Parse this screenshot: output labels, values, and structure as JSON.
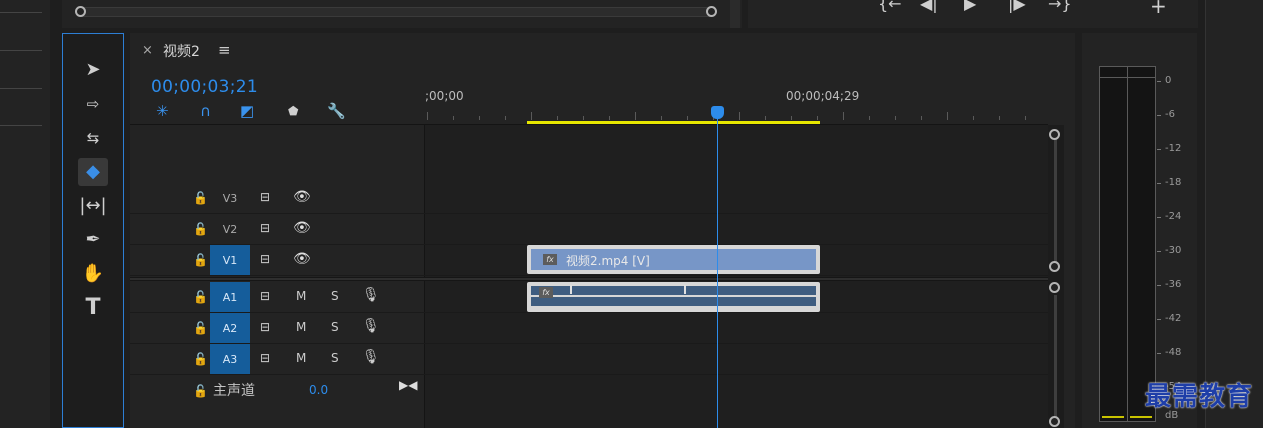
{
  "sequence": {
    "tab_title": "视频2",
    "close_glyph": "×",
    "menu_glyph": "≡",
    "timecode": "00;00;03;21"
  },
  "ruler": {
    "start_label": ";00;00",
    "end_label": "00;00;04;29"
  },
  "tracks": {
    "video": [
      {
        "name": "V3",
        "targeted": false
      },
      {
        "name": "V2",
        "targeted": false
      },
      {
        "name": "V1",
        "targeted": true
      }
    ],
    "audio": [
      {
        "name": "A1",
        "targeted": true,
        "mute": "M",
        "solo": "S"
      },
      {
        "name": "A2",
        "targeted": true,
        "mute": "M",
        "solo": "S"
      },
      {
        "name": "A3",
        "targeted": true,
        "mute": "M",
        "solo": "S"
      }
    ],
    "master": {
      "label": "主声道",
      "value": "0.0"
    }
  },
  "clips": {
    "video_label": "视频2.mp4 [V]",
    "fx_glyph": "fx"
  },
  "meter": {
    "db_scale": [
      "0",
      "-6",
      "-12",
      "-18",
      "-24",
      "-30",
      "-36",
      "-42",
      "-48",
      "-54",
      "dB"
    ]
  },
  "watermark": "最需教育",
  "colors": {
    "accent": "#2d8ceb",
    "track_target": "#155d9b",
    "work_area": "#e6e600",
    "video_clip": "#7796c7",
    "audio_clip": "#3f5d80"
  },
  "icons": {
    "tools": [
      "selection-icon",
      "track-select-icon",
      "ripple-edit-icon",
      "razor-icon",
      "slip-icon",
      "pen-icon",
      "hand-icon",
      "type-icon"
    ],
    "timeline_tools": [
      "nest-icon",
      "snap-icon",
      "linked-selection-icon",
      "marker-icon",
      "wrench-icon"
    ],
    "program": [
      "step-back-icon",
      "step-frame-back-icon",
      "play-icon",
      "step-frame-forward-icon",
      "go-to-out-icon",
      "add-icon"
    ]
  }
}
